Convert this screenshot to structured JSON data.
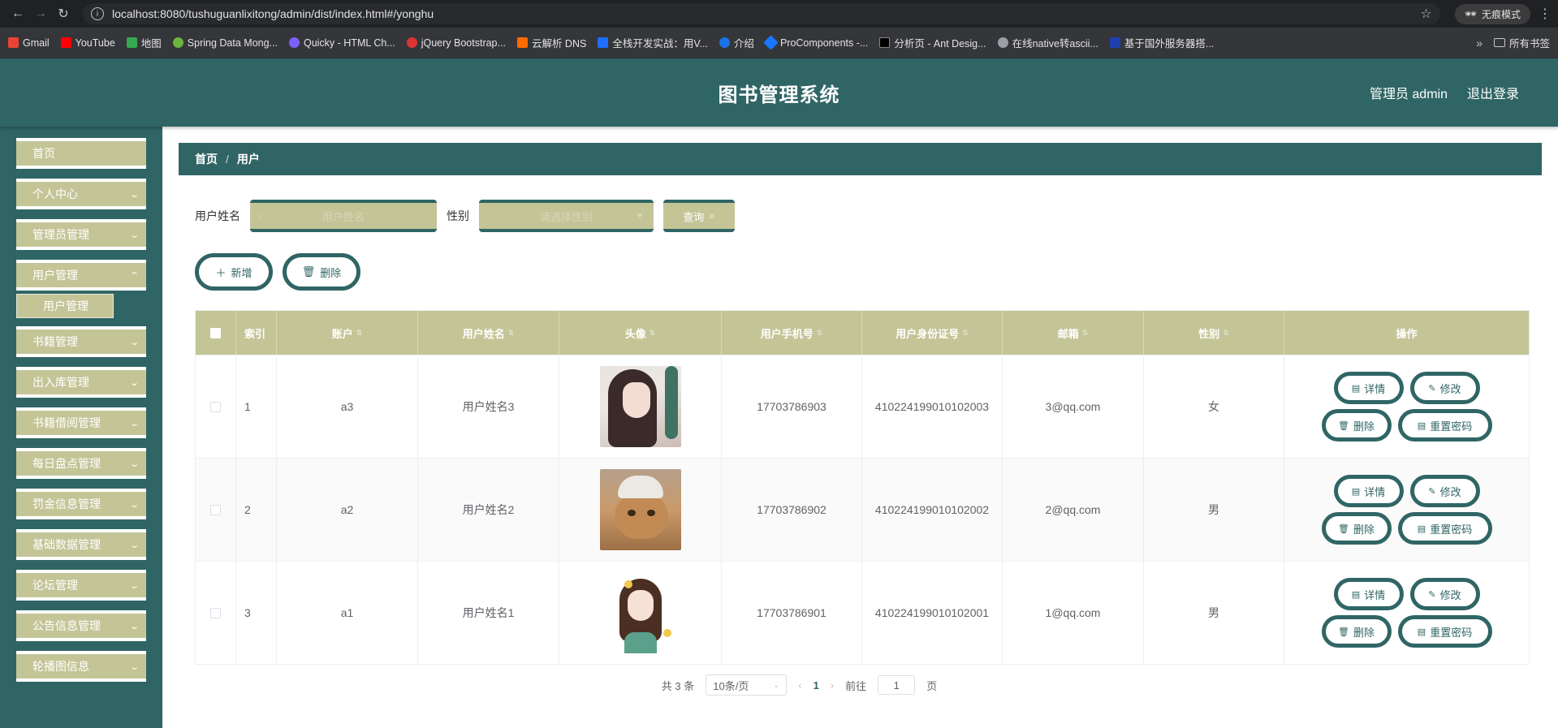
{
  "browser": {
    "url": "localhost:8080/tushuguanlixitong/admin/dist/index.html#/yonghu",
    "incognito_label": "无痕模式",
    "bookmarks": [
      {
        "label": "Gmail",
        "color": "#ea4335"
      },
      {
        "label": "YouTube",
        "color": "#ff0000"
      },
      {
        "label": "地图",
        "color": "#34a853"
      },
      {
        "label": "Spring Data Mong...",
        "color": "#6db33f"
      },
      {
        "label": "Quicky - HTML Ch...",
        "color": "#7b61ff"
      },
      {
        "label": "jQuery Bootstrap...",
        "color": "#d33"
      },
      {
        "label": "云解析 DNS",
        "color": "#ff6a00"
      },
      {
        "label": "全栈开发实战：用V...",
        "color": "#1e6fff"
      },
      {
        "label": "介绍",
        "color": "#1a73e8"
      },
      {
        "label": "ProComponents -...",
        "color": "#1677ff"
      },
      {
        "label": "分析页 - Ant Desig...",
        "color": "#000000"
      },
      {
        "label": "在线native转ascii...",
        "color": "#9aa0a6"
      },
      {
        "label": "基于国外服务器搭...",
        "color": "#1e40af"
      }
    ],
    "all_bookmarks": "所有书签"
  },
  "header": {
    "title": "图书管理系统",
    "user": "管理员 admin",
    "logout": "退出登录"
  },
  "sidebar": {
    "items": [
      {
        "label": "首页",
        "has_children": false
      },
      {
        "label": "个人中心",
        "has_children": true
      },
      {
        "label": "管理员管理",
        "has_children": true
      },
      {
        "label": "用户管理",
        "has_children": true
      },
      {
        "label": "书籍管理",
        "has_children": true
      },
      {
        "label": "出入库管理",
        "has_children": true
      },
      {
        "label": "书籍借阅管理",
        "has_children": true
      },
      {
        "label": "每日盘点管理",
        "has_children": true
      },
      {
        "label": "罚金信息管理",
        "has_children": true
      },
      {
        "label": "基础数据管理",
        "has_children": true
      },
      {
        "label": "论坛管理",
        "has_children": true
      },
      {
        "label": "公告信息管理",
        "has_children": true
      },
      {
        "label": "轮播图信息",
        "has_children": true
      }
    ],
    "submenu": {
      "label": "用户管理"
    }
  },
  "breadcrumb": {
    "home": "首页",
    "sep": "/",
    "current": "用户"
  },
  "search": {
    "name_label": "用户姓名",
    "name_placeholder": "用户姓名",
    "sex_label": "性别",
    "sex_placeholder": "请选择性别",
    "query_button": "查询"
  },
  "actions": {
    "add": "新增",
    "delete": "删除"
  },
  "table": {
    "headers": [
      "索引",
      "账户",
      "用户姓名",
      "头像",
      "用户手机号",
      "用户身份证号",
      "邮箱",
      "性别",
      "操作"
    ],
    "rows": [
      {
        "index": "1",
        "account": "a3",
        "name": "用户姓名3",
        "phone": "17703786903",
        "idcard": "410224199010102003",
        "email": "3@qq.com",
        "sex": "女"
      },
      {
        "index": "2",
        "account": "a2",
        "name": "用户姓名2",
        "phone": "17703786902",
        "idcard": "410224199010102002",
        "email": "2@qq.com",
        "sex": "男"
      },
      {
        "index": "3",
        "account": "a1",
        "name": "用户姓名1",
        "phone": "17703786901",
        "idcard": "410224199010102001",
        "email": "1@qq.com",
        "sex": "男"
      }
    ],
    "row_ops": {
      "detail": "详情",
      "edit": "修改",
      "delete": "删除",
      "reset_pwd": "重置密码"
    }
  },
  "pagination": {
    "total": "共 3 条",
    "page_size": "10条/页",
    "current_page": "1",
    "goto_prefix": "前往",
    "goto_value": "1",
    "goto_suffix": "页"
  },
  "colors": {
    "primary": "#306565",
    "accent": "#c4c597"
  }
}
